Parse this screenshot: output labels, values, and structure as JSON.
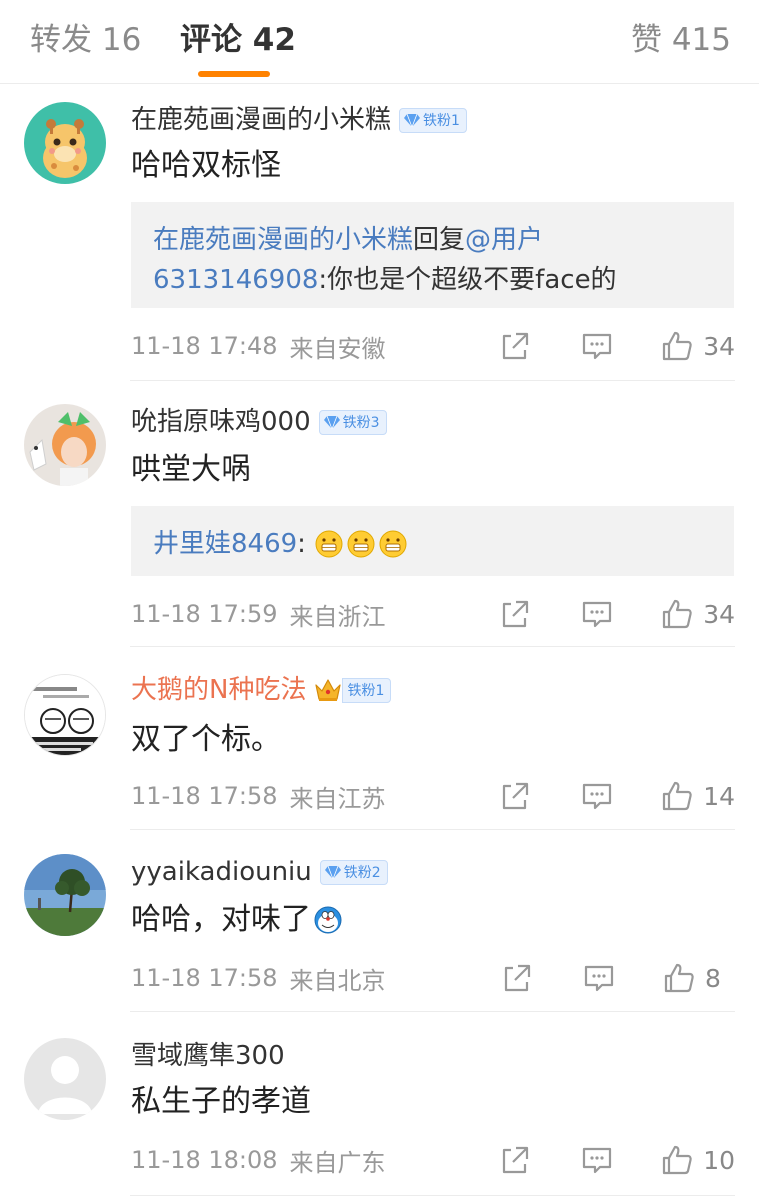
{
  "tabs": {
    "repost": "转发 16",
    "comments": "评论 42",
    "likes": "赞 415"
  },
  "colors": {
    "accent": "#ff8200",
    "link": "#4a7cbf",
    "vip_name": "#eb7350",
    "badge_bg": "#e8f1fd",
    "badge_text": "#4a8fe2"
  },
  "comments": [
    {
      "username": "在鹿苑画漫画的小米糕",
      "badge": "铁粉1",
      "avatar": "giraffe-avatar",
      "text": "哈哈双标怪",
      "reply": {
        "author": "在鹿苑画漫画的小米糕",
        "verb": "回复",
        "target_a": "@用户",
        "target_b": "6313146908",
        "text": ":你也是个超级不要face的"
      },
      "time": "11-18 17:48",
      "source": "来自安徽",
      "likes": "34"
    },
    {
      "username": "吮指原味鸡000",
      "badge": "铁粉3",
      "avatar": "cosplay-photo-avatar",
      "text": "哄堂大㖞",
      "reply": {
        "author": "井里娃8469",
        "text": ":",
        "emojis": [
          "grin-emoji",
          "grin-emoji",
          "grin-emoji"
        ]
      },
      "time": "11-18 17:59",
      "source": "来自浙江",
      "likes": "34"
    },
    {
      "username": "大鹅的N种吃法",
      "badge": "铁粉1",
      "avatar": "comic-avatar",
      "crown": "crown-icon",
      "text": "双了个标。",
      "time": "11-18 17:58",
      "source": "来自江苏",
      "likes": "14"
    },
    {
      "username": "yyaikadiouniu",
      "badge": "铁粉2",
      "avatar": "landscape-avatar",
      "text": "哈哈，对味了",
      "emoji": "doraemon-emoji",
      "time": "11-18 17:58",
      "source": "来自北京",
      "likes": "8"
    },
    {
      "username": "雪域鹰隼300",
      "avatar": "default-avatar",
      "text": "私生子的孝道",
      "time": "11-18 18:08",
      "source": "来自广东",
      "likes": "10"
    }
  ]
}
